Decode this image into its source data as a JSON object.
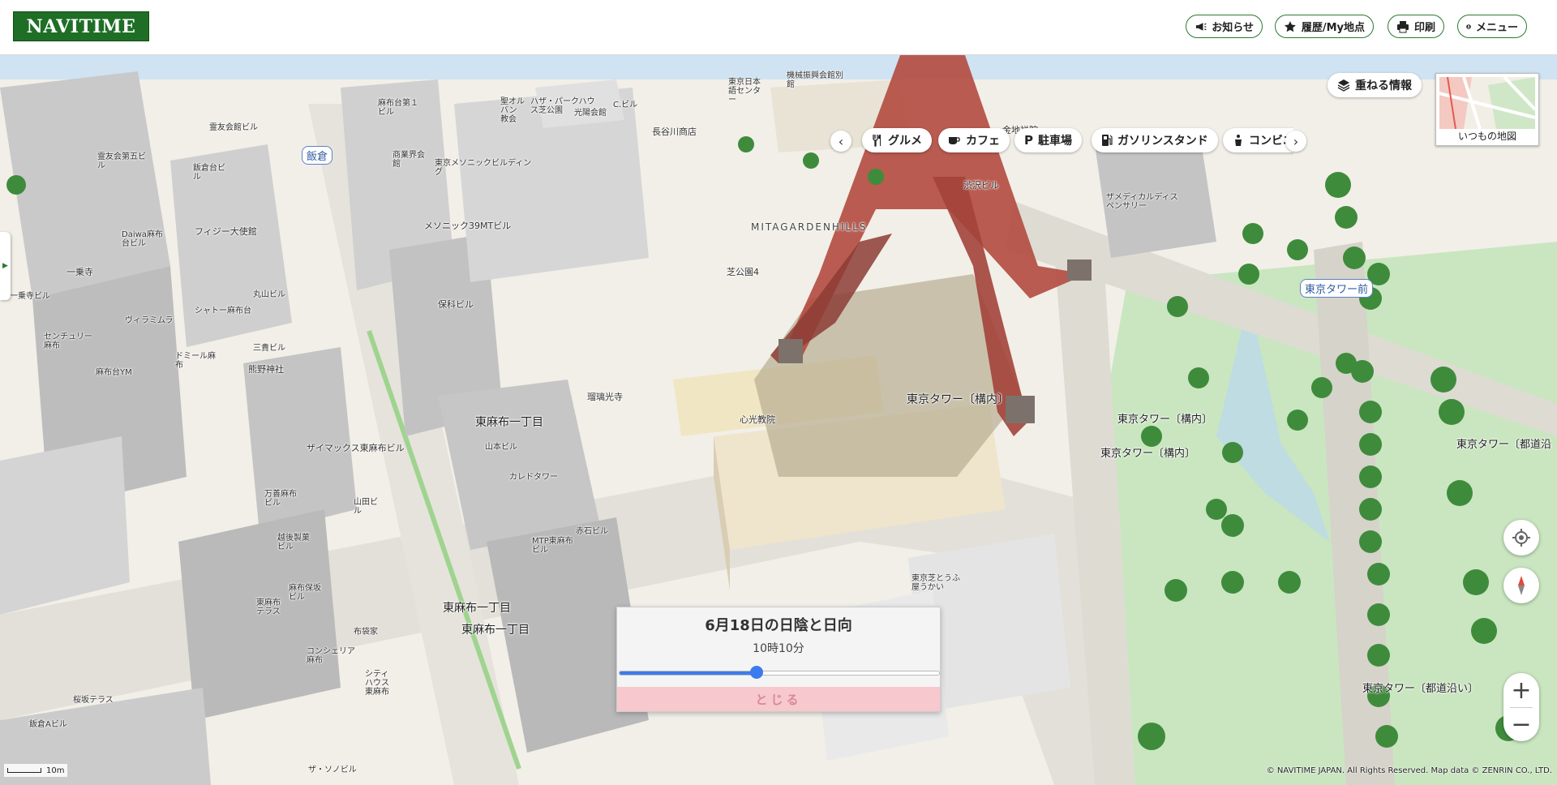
{
  "header": {
    "logo": "NAVITIME",
    "buttons": [
      {
        "label": "お知らせ",
        "icon": "megaphone-icon"
      },
      {
        "label": "履歴/My地点",
        "icon": "star-icon"
      },
      {
        "label": "印刷",
        "icon": "printer-icon"
      },
      {
        "label": "メニュー",
        "icon": "user-icon"
      }
    ]
  },
  "categories": {
    "items": [
      {
        "label": "グルメ",
        "icon": "fork-knife-icon"
      },
      {
        "label": "カフェ",
        "icon": "coffee-cup-icon"
      },
      {
        "label": "駐車場",
        "icon": "parking-icon"
      },
      {
        "label": "ガソリンスタンド",
        "icon": "gas-station-icon"
      },
      {
        "label": "コンビニ",
        "icon": "convenience-store-icon"
      }
    ],
    "prev_icon": "chevron-left-icon",
    "next_icon": "chevron-right-icon"
  },
  "overlay_button": {
    "label": "重ねる情報",
    "icon": "layers-icon"
  },
  "minimap": {
    "label": "いつもの地図"
  },
  "map_labels": {
    "station_iikura": "飯倉",
    "station_tokyotower_mae": "東京タワー前",
    "mita_garden_hills": "MITAGARDENHILLS",
    "shiba_park": "芝公園4",
    "tokyo_tower_konai": "東京タワー〔構内〕",
    "tokyo_tower_konai_2": "東京タワー〔構内〕",
    "tokyo_tower_konai_3": "東京タワー〔構内〕",
    "tokyo_tower_dodo": "東京タワー〔都道沿い〕",
    "tokyo_tower_dodo_edge": "東京タワー〔都道沿",
    "higashi_azabu_1": "東麻布一丁目",
    "higashi_azabu_2": "東麻布一丁目",
    "higashi_azabu_3": "東麻布一丁目",
    "ruri_koji": "瑠璃光寺",
    "shinko_church": "心光教院",
    "konchi_in": "金地禅院",
    "shibusawa": "渋沢ビル",
    "the_medical": "ザメディカルディスペンサリー",
    "masonic": "メソニック39MTビル",
    "masonic_building": "東京メソニックビルディング",
    "hoka": "保科ビル",
    "fiji": "フィジー大使館",
    "ichijo_ji": "一乗寺",
    "ichijo_ji_bldg": "一乗寺ビル",
    "daiwa": "Daiwa麻布台ビル",
    "seiyukai": "霊友会第五ビル",
    "seiyukai_bldg": "霊友会館ビル",
    "iikuradai": "飯倉台ビル",
    "azabu_daiichi": "麻布台第１ビル",
    "shoei": "商業界会館",
    "villa": "ヴィラミムラ",
    "sharto": "シャトー麻布台",
    "marui": "丸山ビル",
    "century": "センチュリー麻布",
    "dormir": "ドミール麻布",
    "azabudai_ym": "麻布台YM",
    "sanki": "三貴ビル",
    "kumano": "熊野神社",
    "xymax": "ザイマックス東麻布ビル",
    "yamamoto": "山本ビル",
    "caledo": "カレドタワー",
    "mtp": "MTP東麻布ビル",
    "akaishi": "赤石ビル",
    "manbi": "万善麻布ビル",
    "yamada": "山田ビル",
    "echigo": "越後製菓ビル",
    "azabu_terrace": "東麻布テラス",
    "azabu_hoka": "麻布保坂ビル",
    "nunobukuro": "布袋家",
    "concieria": "コンシェリア麻布",
    "city_house": "シティハウス東麻布",
    "sakurazaka": "桜坂テラス",
    "iikura_a": "飯倉Aビル",
    "the_sonoview": "ザ・ソノビル",
    "tokyo_shiba_tofu": "東京芝とうふ屋うかい",
    "hasegawa": "長谷川商店",
    "kikai": "機械振興会館別館",
    "nihon_shiko": "東京日本語センター",
    "seiolive": "聖オルバン教会",
    "park_house": "ハザ・パークハウス芝公園",
    "kouyo": "光陽会館",
    "cbuild": "C.ビル"
  },
  "shadow_panel": {
    "title": "6月18日の日陰と日向",
    "time": "10時10分",
    "progress": 0.43,
    "close_label": "とじる"
  },
  "scale_label": "10m",
  "copyright": "© NAVITIME JAPAN. All Rights Reserved. Map data © ZENRIN CO., LTD.",
  "colors": {
    "brand_green": "#1f6e26",
    "slider_blue": "#3b7bef",
    "close_pink": "#f7c8cd",
    "tower_red": "#b34a3f"
  }
}
